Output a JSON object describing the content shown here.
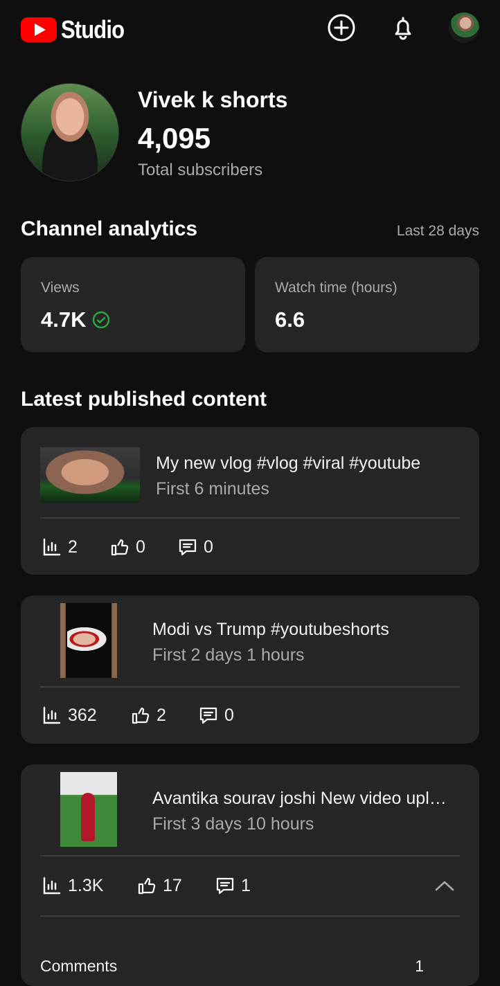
{
  "header": {
    "app_name": "Studio",
    "icons": [
      "create-icon",
      "bell-icon",
      "account-avatar"
    ]
  },
  "channel": {
    "name": "Vivek k shorts",
    "subscribers": "4,095",
    "subscribers_label": "Total subscribers"
  },
  "analytics": {
    "title": "Channel analytics",
    "period": "Last 28 days",
    "views_label": "Views",
    "views_value": "4.7K",
    "watch_label": "Watch time (hours)",
    "watch_value": "6.6"
  },
  "latest": {
    "title": "Latest published content",
    "items": [
      {
        "title": "My new vlog #vlog #viral #youtube",
        "period": "First 6 minutes",
        "views": "2",
        "likes": "0",
        "comments": "0"
      },
      {
        "title": "Modi vs Trump #youtubeshorts",
        "period": "First 2 days 1 hours",
        "views": "362",
        "likes": "2",
        "comments": "0"
      },
      {
        "title": "Avantika sourav joshi New video upl…",
        "period": "First 3 days 10 hours",
        "views": "1.3K",
        "likes": "17",
        "comments": "1",
        "expanded_label": "Comments",
        "expanded_value": "1"
      }
    ]
  },
  "colors": {
    "background": "#0f0f0f",
    "card": "#262626",
    "brand_red": "#ff0000",
    "check_green": "#2ba640"
  }
}
